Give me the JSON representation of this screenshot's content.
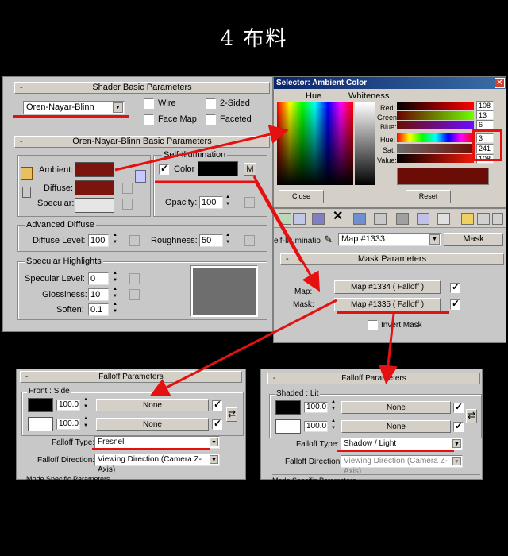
{
  "page_title": "4 布料",
  "shader": {
    "rollout_title": "Shader Basic Parameters",
    "shader_type": "Oren-Nayar-Blinn",
    "wire": "Wire",
    "two_sided": "2-Sided",
    "face_map": "Face Map",
    "faceted": "Faceted"
  },
  "onb": {
    "rollout_title": "Oren-Nayar-Blinn Basic Parameters",
    "ambient": "Ambient:",
    "diffuse": "Diffuse:",
    "specular": "Specular:",
    "self_illum_title": "Self-Illumination",
    "color": "Color",
    "m_button": "M",
    "opacity_label": "Opacity:",
    "opacity_value": "100",
    "adv_diffuse_title": "Advanced Diffuse",
    "diffuse_level_label": "Diffuse Level:",
    "diffuse_level": "100",
    "roughness_label": "Roughness:",
    "roughness": "50",
    "spec_title": "Specular Highlights",
    "spec_level_label": "Specular Level:",
    "spec_level": "0",
    "gloss_label": "Glossiness:",
    "gloss": "10",
    "soften_label": "Soften:",
    "soften": "0.1",
    "colors": {
      "ambient": "#7a140c",
      "diffuse": "#7a140c",
      "specular": "#e6e6e6",
      "self_illum": "#000000",
      "highlight": "#6e6e6e"
    }
  },
  "selector": {
    "title": "Selector: Ambient Color",
    "hue_header": "Hue",
    "whiteness_header": "Whiteness",
    "red_label": "Red:",
    "red": "108",
    "green_label": "Green:",
    "green": "13",
    "blue_label": "Blue:",
    "blue": "6",
    "hue_label": "Hue:",
    "hue": "3",
    "sat_label": "Sat:",
    "sat": "241",
    "value_label": "Value:",
    "value": "108",
    "close": "Close",
    "reset": "Reset",
    "preview_color": "#6b0d06"
  },
  "mask": {
    "toolbar_self_illum": "elf-Illuminatio",
    "map_name": "Map #1333",
    "type_button": "Mask",
    "rollout_title": "Mask Parameters",
    "map_label": "Map:",
    "map_value": "Map #1334  ( Falloff )",
    "mask_label": "Mask:",
    "mask_value": "Map #1335  ( Falloff )",
    "invert": "Invert Mask"
  },
  "falloff_left": {
    "rollout_title": "Falloff Parameters",
    "group_title": "Front : Side",
    "value1": "100.0",
    "value2": "100.0",
    "none1": "None",
    "none2": "None",
    "type_label": "Falloff Type:",
    "type_value": "Fresnel",
    "dir_label": "Falloff Direction:",
    "dir_value": "Viewing Direction (Camera Z-Axis)",
    "mode_title": "Mode Specific Parameters"
  },
  "falloff_right": {
    "rollout_title": "Falloff Parameters",
    "group_title": "Shaded : Lit",
    "value1": "100.0",
    "value2": "100.0",
    "none1": "None",
    "none2": "None",
    "type_label": "Falloff Type:",
    "type_value": "Shadow / Light",
    "dir_label": "Falloff Direction:",
    "dir_value": "Viewing Direction (Camera Z-Axis)",
    "mode_title": "Mode Specific Parameters"
  },
  "accent_color": "#e51010"
}
